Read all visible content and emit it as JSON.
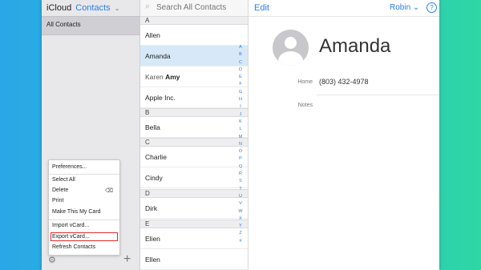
{
  "app": {
    "brand": "iCloud",
    "section": "Contacts",
    "chevron": "⌄"
  },
  "sidebar": {
    "all_contacts": "All Contacts"
  },
  "menu": {
    "items": [
      "Preferences...",
      "Select All",
      "Delete",
      "Print",
      "Make This My Card",
      "Import vCard...",
      "Export vCard...",
      "Refresh Contacts"
    ],
    "highlighted": "Export vCard..."
  },
  "search": {
    "placeholder": "Search All Contacts"
  },
  "list": {
    "headers": [
      "A",
      "B",
      "C",
      "D",
      "E"
    ],
    "rows": [
      {
        "first": "Allen",
        "last": ""
      },
      {
        "first": "Amanda",
        "last": ""
      },
      {
        "first": "Karen",
        "last": "Amy"
      },
      {
        "first": "Apple Inc.",
        "last": ""
      },
      {
        "first": "Bella",
        "last": ""
      },
      {
        "first": "Charlie",
        "last": ""
      },
      {
        "first": "Cindy",
        "last": ""
      },
      {
        "first": "Dirk",
        "last": ""
      },
      {
        "first": "Elien",
        "last": ""
      },
      {
        "first": "Ellen",
        "last": ""
      }
    ],
    "selected": "Amanda",
    "alpha_index": [
      "A",
      "B",
      "C",
      "D",
      "E",
      "F",
      "G",
      "H",
      "I",
      "J",
      "K",
      "L",
      "M",
      "N",
      "O",
      "P",
      "Q",
      "R",
      "S",
      "T",
      "U",
      "V",
      "W",
      "X",
      "Y",
      "Z",
      "#"
    ]
  },
  "detail": {
    "edit_label": "Edit",
    "user_label": "Robin",
    "user_chevron": "⌄",
    "help_label": "?",
    "name": "Amanda",
    "home_label": "Home",
    "home_value": "(803) 432-4978",
    "notes_label": "Notes"
  },
  "colors": {
    "accent": "#2b7de9",
    "selected_row": "#d7e9f8",
    "highlight_box": "#e02b2b"
  }
}
